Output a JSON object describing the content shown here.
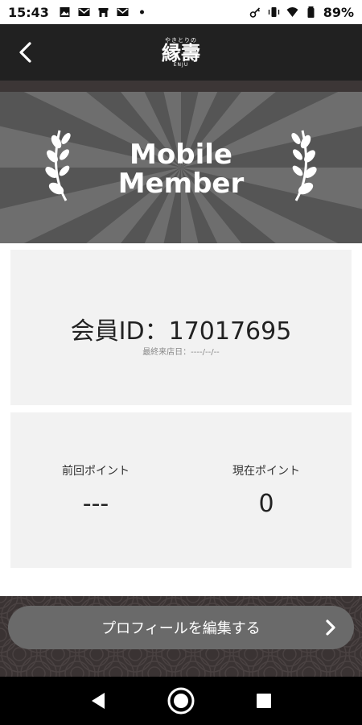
{
  "status_bar": {
    "time": "15:43",
    "battery": "89%",
    "notification_icons": [
      "image-icon",
      "gmail-icon",
      "store-icon",
      "gmail-icon",
      "dot-icon"
    ],
    "system_icons": [
      "key-icon",
      "vibrate-icon",
      "wifi-icon",
      "battery-icon"
    ]
  },
  "app_bar": {
    "logo_small": "やきとりの",
    "logo_main": "縁壽",
    "logo_sub": "ENJU"
  },
  "hero": {
    "title_line1": "Mobile",
    "title_line2": "Member"
  },
  "member": {
    "id_text": "会員ID：17017695",
    "last_visit": "最終来店日：----/--/--"
  },
  "points": {
    "previous_label": "前回ポイント",
    "previous_value": "---",
    "current_label": "現在ポイント",
    "current_value": "0"
  },
  "actions": {
    "edit_profile_label": "プロフィールを編集する"
  },
  "colors": {
    "app_bar": "#212121",
    "hero_bg": "#555555",
    "card_bg": "#f2f2f2",
    "button_bg": "#6a6a6a",
    "bottom_bg": "#3a3333"
  }
}
